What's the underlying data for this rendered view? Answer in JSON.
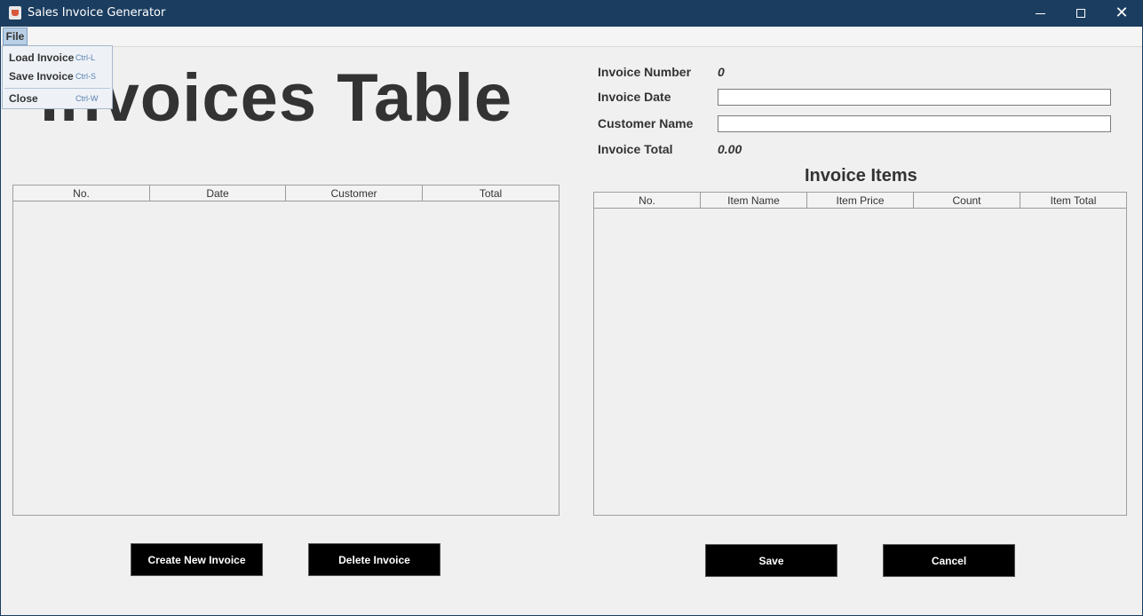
{
  "window": {
    "title": "Sales Invoice Generator",
    "controls": {
      "minimize": "minimize",
      "maximize": "maximize",
      "close": "✕"
    }
  },
  "menubar": {
    "file_label": "File",
    "file_menu": {
      "items": [
        {
          "label": "Load Invoice",
          "shortcut": "Ctrl-L"
        },
        {
          "label": "Save Invoice",
          "shortcut": "Ctrl-S"
        },
        {
          "label": "Close",
          "shortcut": "Ctrl-W"
        }
      ]
    }
  },
  "left_panel": {
    "heading": "Invoices Table",
    "table": {
      "columns": [
        "No.",
        "Date",
        "Customer",
        "Total"
      ],
      "rows": []
    },
    "buttons": {
      "create": "Create New Invoice",
      "delete": "Delete Invoice"
    }
  },
  "right_panel": {
    "invoice_number_label": "Invoice Number",
    "invoice_number_value": "0",
    "invoice_date_label": "Invoice Date",
    "invoice_date_value": "",
    "customer_name_label": "Customer Name",
    "customer_name_value": "",
    "invoice_total_label": "Invoice Total",
    "invoice_total_value": "0.00",
    "items_title": "Invoice Items",
    "items_table": {
      "columns": [
        "No.",
        "Item Name",
        "Item Price",
        "Count",
        "Item Total"
      ],
      "rows": []
    },
    "buttons": {
      "save": "Save",
      "cancel": "Cancel"
    }
  },
  "colors": {
    "titlebar": "#1b3d5f",
    "button_bg": "#000000",
    "menu_highlight": "#b8cfe5"
  }
}
